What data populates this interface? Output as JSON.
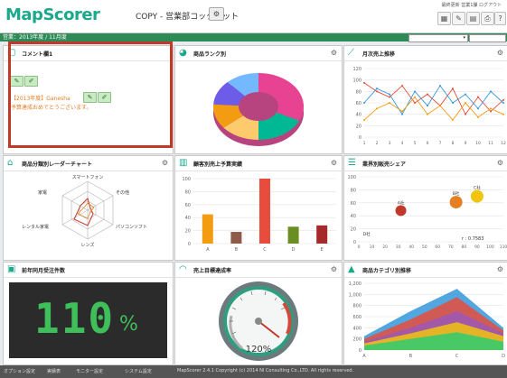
{
  "header": {
    "logo": "MapScorer",
    "cockpit_title": "COPY - 営業部コックピット",
    "cockpit_button": "⚙",
    "user_info_line1": "最終更新 営業1課",
    "user_info_line2": "ログアウト"
  },
  "subbar": {
    "text": "営業：2013年度 / 11月度",
    "dropdown1_value": "",
    "dropdown2_value": ""
  },
  "panels": {
    "comment": {
      "title": "コメント欄1",
      "entry_author": "【2013年度】Ganesha",
      "entry_text": "予算達成おめでとうございます。"
    },
    "donut": {
      "title": "商品ランク別"
    },
    "monthly": {
      "title": "月次売上推移"
    },
    "radar": {
      "title": "商品分類別レーダーチャート",
      "labels": [
        "スマートフォン",
        "その他",
        "パソコンソフト",
        "レンズ",
        "レンタル家電",
        "家電"
      ]
    },
    "budget": {
      "title": "顧客別売上予算実績"
    },
    "share": {
      "title": "業界別販売シェア",
      "r_value": "r : 0.7583",
      "dot_labels": [
        "A社",
        "B社",
        "C社",
        "D社"
      ]
    },
    "yoy": {
      "title": "前年同月受注件数",
      "value": "110",
      "unit": "%"
    },
    "achievement": {
      "title": "売上目標達成率",
      "value": "120%"
    },
    "category": {
      "title": "商品カテゴリ別推移"
    }
  },
  "footer": {
    "items": [
      "オプション設定",
      "実績表",
      "モニター設定",
      "システム設定"
    ],
    "copyright": "MapScorer 2.4.1 Copyright (c) 2014 NI Consulting Co.,LTD. All rights reserved."
  },
  "colors": {
    "accent": "#1ba88b",
    "highlight_border": "#c0392b"
  },
  "chart_data": [
    {
      "type": "pie",
      "title": "",
      "values": [
        32,
        18,
        14,
        12,
        12,
        12
      ],
      "colors": [
        "#e84393",
        "#00b894",
        "#fdcb6e",
        "#f39c12",
        "#6c5ce7",
        "#74b9ff"
      ]
    },
    {
      "type": "line",
      "title": "",
      "categories": [
        "1",
        "2",
        "3",
        "4",
        "5",
        "6",
        "7",
        "8",
        "9",
        "10",
        "11",
        "12"
      ],
      "ylim": [
        0,
        120
      ],
      "yticks": [
        0,
        20,
        40,
        60,
        80,
        100,
        120
      ],
      "series": [
        {
          "values": [
            95,
            80,
            70,
            90,
            60,
            75,
            55,
            85,
            40,
            70,
            45,
            65
          ],
          "color": "#e74c3c"
        },
        {
          "values": [
            60,
            85,
            75,
            40,
            80,
            55,
            90,
            60,
            75,
            50,
            80,
            60
          ],
          "color": "#3498db"
        },
        {
          "values": [
            30,
            50,
            60,
            45,
            70,
            40,
            55,
            30,
            60,
            35,
            50,
            40
          ],
          "color": "#f39c12"
        }
      ]
    },
    {
      "type": "bar",
      "title": "",
      "categories": [
        "A",
        "B",
        "C",
        "D",
        "E"
      ],
      "values": [
        45,
        18,
        100,
        26,
        28
      ],
      "ylim": [
        0,
        100
      ],
      "yticks": [
        0,
        20,
        40,
        60,
        80,
        100
      ],
      "colors": [
        "#f39c12",
        "#8e5a4a",
        "#e74c3c",
        "#6b8e23",
        "#a52a2a"
      ]
    },
    {
      "type": "scatter",
      "title": "",
      "xlim": [
        0,
        110
      ],
      "ylim": [
        0,
        100
      ],
      "xticks": [
        0,
        10,
        20,
        30,
        40,
        50,
        60,
        70,
        80,
        90,
        100,
        110
      ],
      "yticks": [
        0,
        20,
        40,
        60,
        80,
        100
      ],
      "points": [
        {
          "x": 32,
          "y": 48,
          "size": 6,
          "color": "#c0392b",
          "label": "A社"
        },
        {
          "x": 74,
          "y": 61,
          "size": 7,
          "color": "#e67e22",
          "label": "B社"
        },
        {
          "x": 90,
          "y": 70,
          "size": 7,
          "color": "#f1c40f",
          "label": "C社"
        },
        {
          "x": 6,
          "y": 10,
          "size": 0,
          "color": "#333333",
          "label": "D社"
        }
      ]
    },
    {
      "type": "area",
      "title": "",
      "categories": [
        "A",
        "B",
        "C",
        "D"
      ],
      "ylim": [
        0,
        1200
      ],
      "yticks": [
        0,
        200,
        400,
        600,
        800,
        1000,
        1200
      ],
      "series": [
        {
          "values": [
            250,
            700,
            1100,
            400
          ],
          "color": "#3498db"
        },
        {
          "values": [
            200,
            550,
            950,
            350
          ],
          "color": "#e74c3c"
        },
        {
          "values": [
            150,
            400,
            700,
            300
          ],
          "color": "#9b59b6"
        },
        {
          "values": [
            120,
            300,
            500,
            250
          ],
          "color": "#f1c40f"
        },
        {
          "values": [
            80,
            200,
            320,
            150
          ],
          "color": "#2ecc71"
        }
      ]
    }
  ]
}
